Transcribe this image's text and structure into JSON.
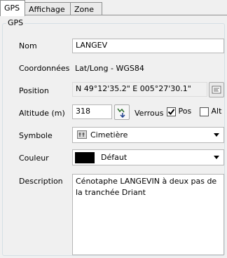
{
  "tabs": [
    {
      "label": "GPS",
      "active": true
    },
    {
      "label": "Affichage",
      "active": false
    },
    {
      "label": "Zone",
      "active": false
    }
  ],
  "group_title": "GPS",
  "nom": {
    "label": "Nom",
    "value": "LANGEV"
  },
  "coordonnees": {
    "label": "Coordonnées",
    "value": "Lat/Long - WGS84"
  },
  "position": {
    "label": "Position",
    "value": "N 49°12'35.2\"  E 005°27'30.1\"",
    "button_icon": "edit-position-icon"
  },
  "altitude": {
    "label": "Altitude (m)",
    "value": "318",
    "button_icon": "altitude-lookup-icon"
  },
  "verrous": {
    "label": "Verrous",
    "pos_label": "Pos",
    "pos_checked": true,
    "alt_label": "Alt",
    "alt_checked": false
  },
  "symbole": {
    "label": "Symbole",
    "value": "Cimetière",
    "icon": "cemetery-icon"
  },
  "couleur": {
    "label": "Couleur",
    "value": "Défaut",
    "swatch_color": "#000000"
  },
  "description": {
    "label": "Description",
    "value": "Cénotaphe LANGEVIN à deux pas de la tranchée Driant"
  }
}
